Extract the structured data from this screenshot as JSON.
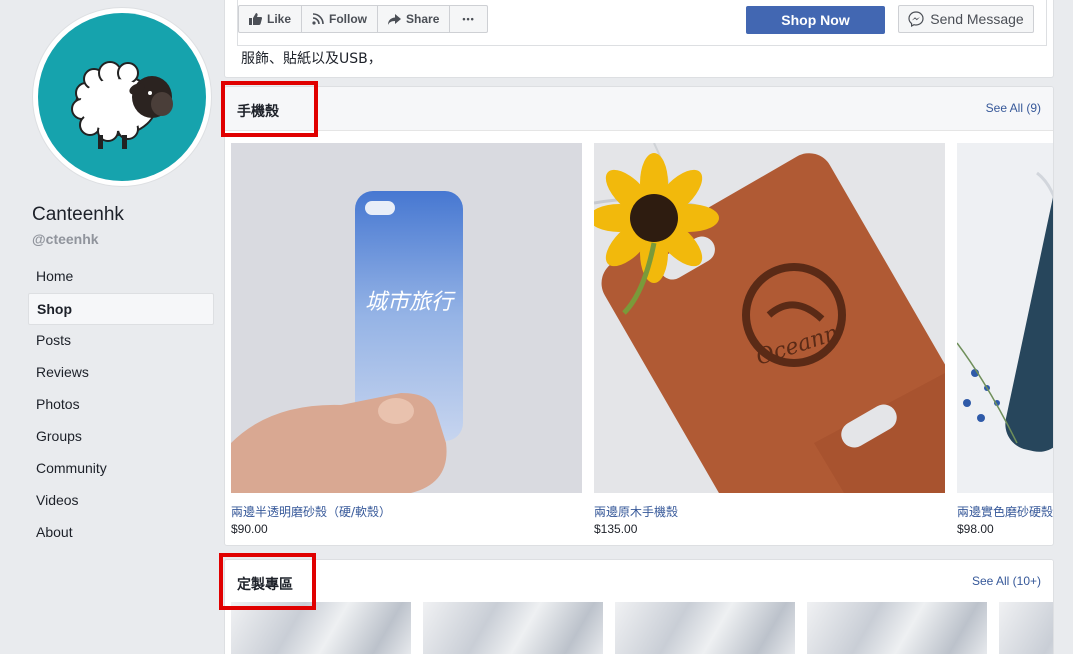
{
  "page": {
    "name": "Canteenhk",
    "handle": "@cteenhk"
  },
  "nav": {
    "items": [
      {
        "label": "Home",
        "active": false
      },
      {
        "label": "Shop",
        "active": true
      },
      {
        "label": "Posts",
        "active": false
      },
      {
        "label": "Reviews",
        "active": false
      },
      {
        "label": "Photos",
        "active": false
      },
      {
        "label": "Groups",
        "active": false
      },
      {
        "label": "Community",
        "active": false
      },
      {
        "label": "Videos",
        "active": false
      },
      {
        "label": "About",
        "active": false
      }
    ]
  },
  "actions": {
    "like": "Like",
    "follow": "Follow",
    "share": "Share",
    "more": "•••",
    "shop_now": "Shop Now",
    "send_message": "Send Message"
  },
  "description": "服飾、貼紙以及USB，",
  "sections": [
    {
      "title": "手機殼",
      "see_all": "See All (9)",
      "products": [
        {
          "name": "兩邊半透明磨砂殼（硬/軟殼）",
          "price": "$90.00",
          "image_text": "城市旅行"
        },
        {
          "name": "兩邊原木手機殼",
          "price": "$135.00",
          "image_text": "Oceann"
        },
        {
          "name": "兩邊實色磨砂硬殼",
          "price": "$98.00",
          "image_text": ""
        }
      ]
    },
    {
      "title": "定製專區",
      "see_all": "See All (10+)"
    }
  ],
  "colors": {
    "brand_blue": "#4267b2",
    "link_blue": "#365899",
    "avatar_teal": "#16a3ad",
    "highlight_red": "#e00000"
  }
}
